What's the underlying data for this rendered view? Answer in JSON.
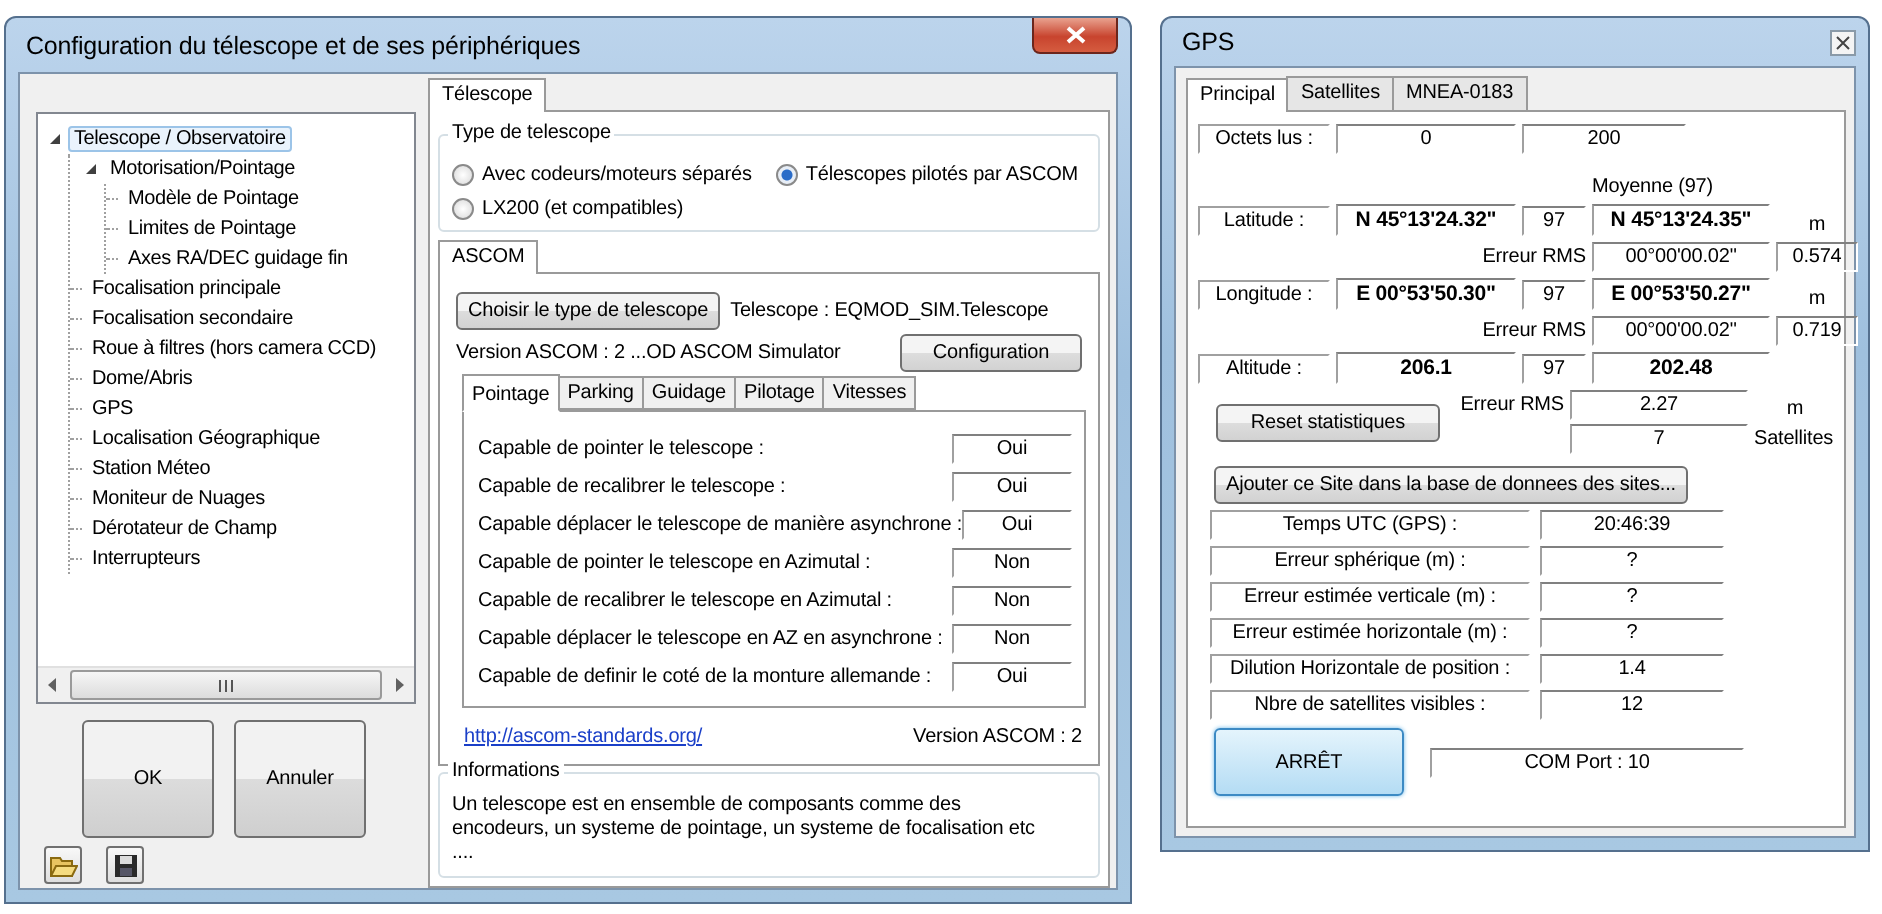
{
  "config_window": {
    "title": "Configuration du télescope et de ses périphériques",
    "tree": [
      {
        "label": "Telescope / Observatoire",
        "selected": true,
        "expanded": true,
        "children": [
          {
            "label": "Motorisation/Pointage",
            "selected": false,
            "expanded": true,
            "children": [
              {
                "label": "Modèle de Pointage",
                "selected": false
              },
              {
                "label": "Limites de Pointage",
                "selected": false
              },
              {
                "label": "Axes RA/DEC guidage fin",
                "selected": false
              }
            ]
          },
          {
            "label": "Focalisation principale",
            "selected": false
          },
          {
            "label": "Focalisation secondaire",
            "selected": false
          },
          {
            "label": "Roue à filtres (hors camera CCD)",
            "selected": false
          },
          {
            "label": "Dome/Abris",
            "selected": false
          },
          {
            "label": "GPS",
            "selected": false
          },
          {
            "label": "Localisation Géographique",
            "selected": false
          },
          {
            "label": "Station Méteo",
            "selected": false
          },
          {
            "label": "Moniteur de Nuages",
            "selected": false
          },
          {
            "label": "Dérotateur de Champ",
            "selected": false
          },
          {
            "label": "Interrupteurs",
            "selected": false
          }
        ]
      }
    ],
    "buttons": [
      "OK",
      "Annuler"
    ],
    "main_tabs": [
      {
        "label": "Télescope",
        "selected": true
      }
    ],
    "telescope_type": {
      "title": "Type de telescope",
      "options": [
        {
          "label": "Avec codeurs/moteurs séparés",
          "selected": false
        },
        {
          "label": "Télescopes pilotés par ASCOM",
          "selected": true
        },
        {
          "label": "LX200 (et compatibles)",
          "selected": false
        }
      ]
    },
    "ascom": {
      "tabs": [
        {
          "label": "ASCOM",
          "selected": true
        }
      ],
      "choose_button": "Choisir le type de telescope",
      "telescope": "Telescope : EQMOD_SIM.Telescope",
      "version": "Version ASCOM : 2 ...OD ASCOM Simulator",
      "config_button": "Configuration",
      "sub_tabs": [
        {
          "label": "Pointage",
          "selected": true
        },
        {
          "label": "Parking",
          "selected": false
        },
        {
          "label": "Guidage",
          "selected": false
        },
        {
          "label": "Pilotage",
          "selected": false
        },
        {
          "label": "Vitesses",
          "selected": false
        }
      ],
      "capabilities": [
        {
          "label": "Capable de pointer le telescope :",
          "value": "Oui"
        },
        {
          "label": "Capable de recalibrer le telescope :",
          "value": "Oui"
        },
        {
          "label": "Capable déplacer le telescope de manière asynchrone :",
          "value": "Oui"
        },
        {
          "label": "Capable de pointer le telescope en Azimutal :",
          "value": "Non"
        },
        {
          "label": "Capable de recalibrer le telescope en Azimutal :",
          "value": "Non"
        },
        {
          "label": "Capable déplacer le telescope en AZ en asynchrone :",
          "value": "Non"
        },
        {
          "label": "Capable de definir le coté de la monture allemande :",
          "value": "Oui"
        }
      ],
      "link": "http://ascom-standards.org/",
      "version_footer": "Version ASCOM : 2"
    },
    "informations": {
      "title": "Informations",
      "text": "Un telescope est en ensemble de composants comme des\nencodeurs, un systeme de pointage, un systeme de focalisation etc\n...."
    }
  },
  "gps_window": {
    "title": "GPS",
    "tabs": [
      {
        "label": "Principal",
        "selected": true
      },
      {
        "label": "Satellites",
        "selected": false
      },
      {
        "label": "MNEA-0183",
        "selected": false
      }
    ],
    "bytes": {
      "label": "Octets lus :",
      "values": [
        "0",
        "200"
      ]
    },
    "average_heading": "Moyenne (97)",
    "positions": [
      {
        "label": "Latitude :",
        "value": "N 45°13'24.32\"",
        "count": "97",
        "average": "N 45°13'24.35\"",
        "unit": "m",
        "rms_label": "Erreur RMS",
        "rms": "00°00'00.02\"",
        "rms_value": "0.574"
      },
      {
        "label": "Longitude :",
        "value": "E 00°53'50.30\"",
        "count": "97",
        "average": "E 00°53'50.27\"",
        "unit": "m",
        "rms_label": "Erreur RMS",
        "rms": "00°00'00.02\"",
        "rms_value": "0.719"
      },
      {
        "label": "Altitude :",
        "value": "206.1",
        "count": "97",
        "average": "202.48",
        "rms_label": "Erreur RMS",
        "rms": "2.27",
        "rms_unit": "m"
      }
    ],
    "reset_button": "Reset statistiques",
    "satellites": {
      "value": "7",
      "label": "Satellites"
    },
    "add_site_button": "Ajouter ce Site dans la base de donnees des sites...",
    "status": [
      {
        "label": "Temps UTC (GPS) :",
        "value": "20:46:39"
      },
      {
        "label": "Erreur sphérique (m) :",
        "value": "?"
      },
      {
        "label": "Erreur estimée verticale (m) :",
        "value": "?"
      },
      {
        "label": "Erreur estimée horizontale (m) :",
        "value": "?"
      },
      {
        "label": "Dilution Horizontale de position :",
        "value": "1.4"
      },
      {
        "label": "Nbre de satellites visibles :",
        "value": "12"
      }
    ],
    "stop_button": "ARRÊT",
    "com_port": "COM Port : 10"
  }
}
